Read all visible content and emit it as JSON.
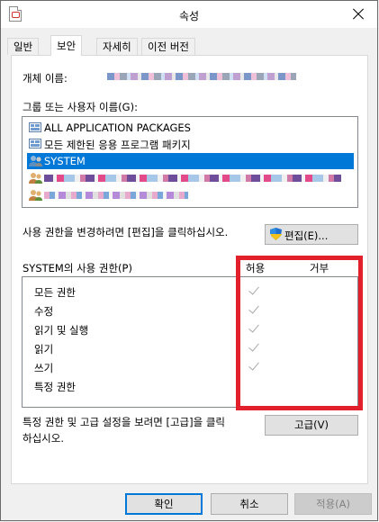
{
  "window": {
    "title": "속성"
  },
  "tabs": [
    {
      "label": "일반"
    },
    {
      "label": "보안"
    },
    {
      "label": "자세히"
    },
    {
      "label": "이전 버전"
    }
  ],
  "security": {
    "object_name_label": "개체 이름:",
    "groups_label": "그룹 또는 사용자 이름(G):",
    "groups": [
      {
        "name": "ALL APPLICATION PACKAGES",
        "icon": "package-group-icon"
      },
      {
        "name": "모든 제한된 응용 프로그램 패키지",
        "icon": "package-group-icon"
      },
      {
        "name": "SYSTEM",
        "icon": "users-icon",
        "selected": true
      },
      {
        "name": "",
        "icon": "users-icon"
      },
      {
        "name": "",
        "icon": "users-icon"
      }
    ],
    "edit_note": "사용 권한을 변경하려면 [편집]을 클릭하십시오.",
    "edit_button": "편집(E)...",
    "permissions_label": "SYSTEM의 사용 권한(P)",
    "allow_header": "허용",
    "deny_header": "거부",
    "permissions": [
      {
        "name": "모든 권한",
        "allow": true,
        "deny": false
      },
      {
        "name": "수정",
        "allow": true,
        "deny": false
      },
      {
        "name": "읽기 및 실행",
        "allow": true,
        "deny": false
      },
      {
        "name": "읽기",
        "allow": true,
        "deny": false
      },
      {
        "name": "쓰기",
        "allow": true,
        "deny": false
      },
      {
        "name": "특정 권한",
        "allow": false,
        "deny": false
      }
    ],
    "advanced_note_line1": "특정 권한 및 고급 설정을 보려면 [고급]을 클릭",
    "advanced_note_line2": "하십시오.",
    "advanced_button": "고급(V)"
  },
  "footer": {
    "ok": "확인",
    "cancel": "취소",
    "apply": "적용(A)"
  },
  "colors": {
    "selection": "#0078d7",
    "highlight": "#e2202b"
  }
}
